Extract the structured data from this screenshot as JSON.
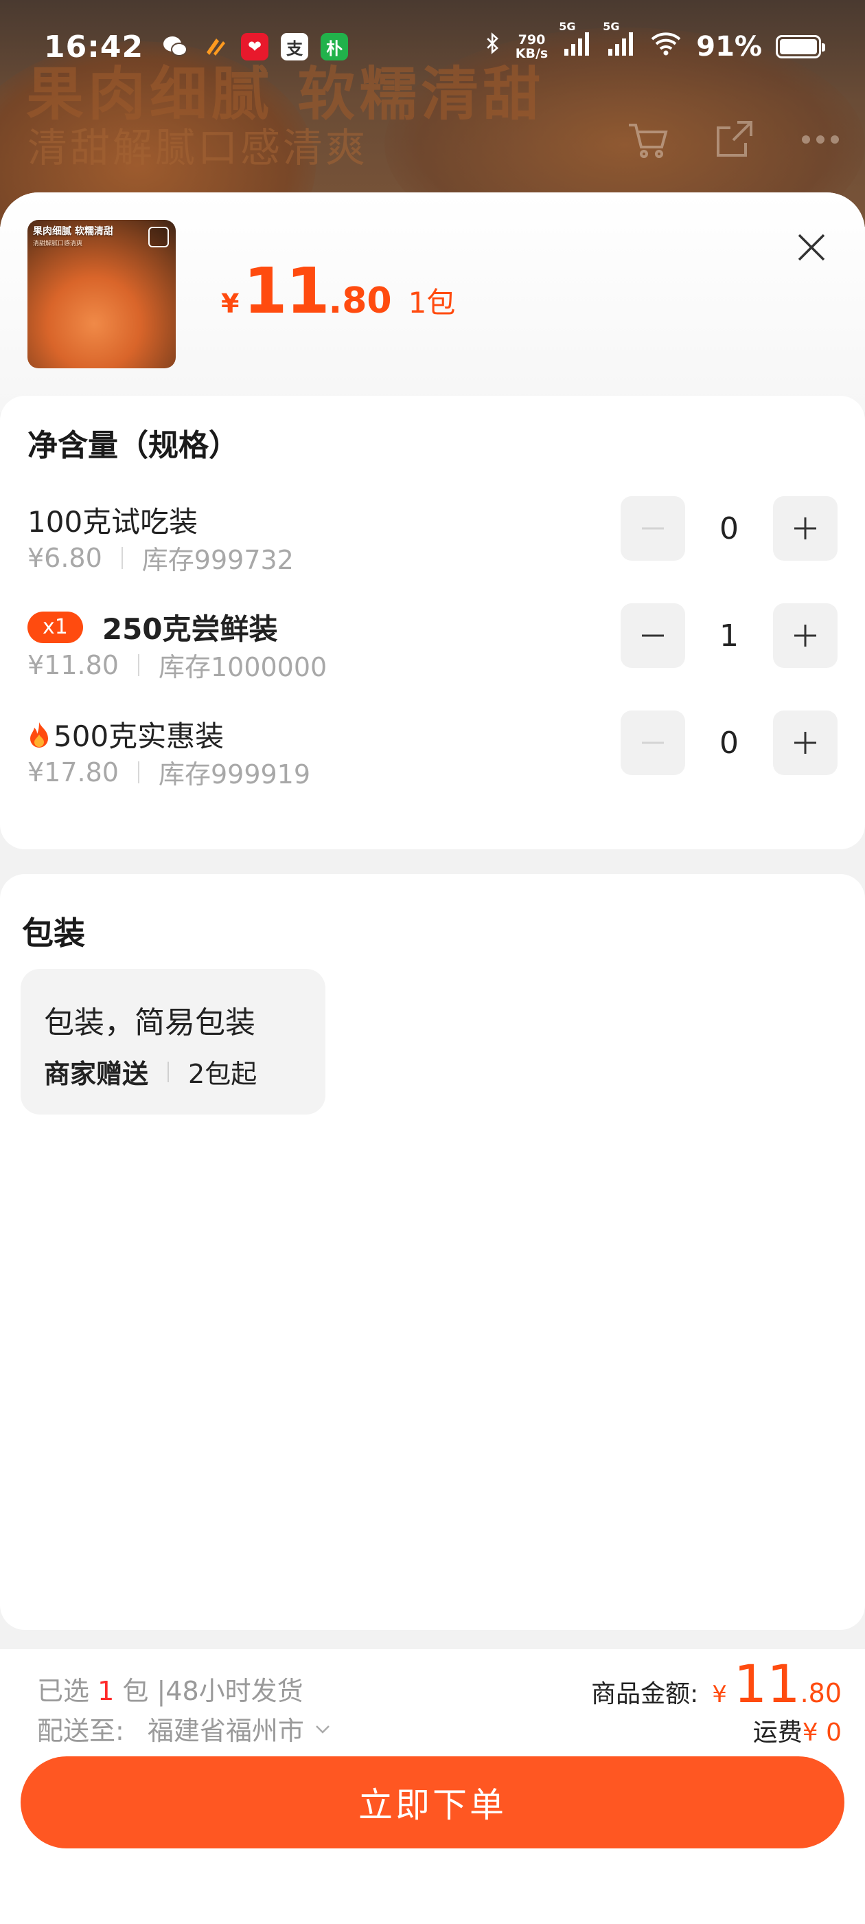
{
  "status_bar": {
    "time": "16:42",
    "net_speed_value": "790",
    "net_speed_unit": "KB/s",
    "net1": "5G",
    "net2": "5G",
    "battery": "91%"
  },
  "background": {
    "headline": "果肉细腻 软糯清甜",
    "subline": "清甜解腻口感清爽"
  },
  "product": {
    "thumb_title": "果肉细腻 软糯清甜",
    "thumb_sub": "清甜解腻口感清爽",
    "currency": "¥",
    "price_int": "11",
    "price_dec": ".80",
    "unit": "1包"
  },
  "spec": {
    "title": "净含量（规格）",
    "items": [
      {
        "name": "100克试吃装",
        "price": "¥6.80",
        "stock": "库存999732",
        "qty": "0"
      },
      {
        "badge": "x1",
        "name": "250克尝鲜装",
        "price": "¥11.80",
        "stock": "库存1000000",
        "qty": "1"
      },
      {
        "name": "500克实惠装",
        "price": "¥17.80",
        "stock": "库存999919",
        "qty": "0"
      }
    ]
  },
  "packaging": {
    "title": "包装",
    "option_name": "包装，简易包装",
    "option_tag": "商家赠送",
    "option_min": "2包起"
  },
  "footer": {
    "selected_prefix": "已选",
    "selected_count": "1",
    "selected_suffix": "包 |48小时发货",
    "ship_label": "配送至:",
    "ship_address": "福建省福州市",
    "total_label": "商品金额:",
    "total_currency": "¥",
    "total_int": "11",
    "total_dec": ".80",
    "freight_label": "运费",
    "freight_value": "¥ 0",
    "order_button": "立即下单"
  },
  "colors": {
    "accent": "#ff4b0f",
    "button": "#ff5722"
  }
}
